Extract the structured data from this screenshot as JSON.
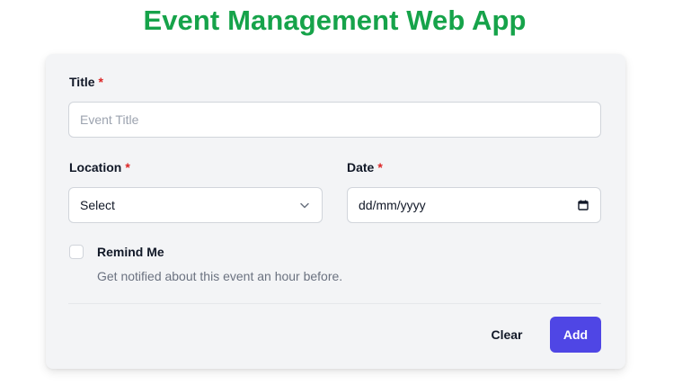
{
  "page": {
    "title": "Event Management Web App"
  },
  "form": {
    "title_label": "Title",
    "title_placeholder": "Event Title",
    "title_value": "",
    "location_label": "Location",
    "location_selected": "Select",
    "date_label": "Date",
    "date_placeholder": "dd/mm/yyyy",
    "required_mark": "*",
    "remind_label": "Remind Me",
    "remind_checked": false,
    "remind_help": "Get notified about this event an hour before.",
    "clear_label": "Clear",
    "add_label": "Add"
  },
  "icons": {
    "location_dropdown": "chevron-down-icon",
    "date_picker": "calendar-icon"
  },
  "colors": {
    "title": "#16a34a",
    "card_background": "#f3f4f6",
    "required": "#dc2626",
    "primary_button": "#4f46e5",
    "helper_text": "#6b7280"
  }
}
